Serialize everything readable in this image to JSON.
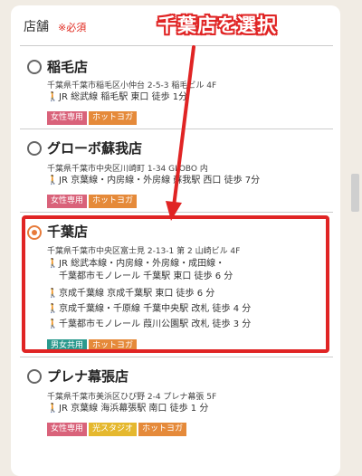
{
  "form": {
    "field_label": "店舗",
    "required_label": "※必須"
  },
  "annotation": {
    "callout_text": "千葉店を選択",
    "color": "#e02424"
  },
  "colors": {
    "women_only": "#d9627a",
    "hot_yoga": "#e58a3a",
    "unisex": "#2a9a8e",
    "light_studio": "#e5b82e",
    "walk_icon": "#e29a2b",
    "radio_selected": "#e77b3b"
  },
  "stores": [
    {
      "name": "稲毛店",
      "selected": false,
      "address": "千葉県千葉市稲毛区小仲台 2-5-3 稲毛ビル 4F",
      "access": [
        "JR 総武線 稲毛駅 東口 徒歩 1分"
      ],
      "tags": [
        "女性専用",
        "ホットヨガ"
      ]
    },
    {
      "name": "グローボ蘇我店",
      "selected": false,
      "address": "千葉県千葉市中央区川崎町 1-34 GLOBO 内",
      "access": [
        "JR 京葉線・内房線・外房線 蘇我駅 西口 徒歩 7分"
      ],
      "tags": [
        "女性専用",
        "ホットヨガ"
      ]
    },
    {
      "name": "千葉店",
      "selected": true,
      "address": "千葉県千葉市中央区富士見 2-13-1 第 2 山崎ビル 4F",
      "access": [
        "JR 総武本線・内房線・外房線・成田線・",
        "千葉都市モノレール 千葉駅 東口 徒歩 6 分",
        "京成千葉線 京成千葉駅 東口 徒歩 6 分",
        "京成千葉線・千原線 千葉中央駅 改札 徒歩 4 分",
        "千葉都市モノレール 葭川公園駅 改札 徒歩 3 分"
      ],
      "tags": [
        "男女共用",
        "ホットヨガ"
      ]
    },
    {
      "name": "プレナ幕張店",
      "selected": false,
      "address": "千葉県千葉市美浜区ひび野 2-4 プレナ幕張 5F",
      "access": [
        "JR 京葉線 海浜幕張駅 南口 徒歩 1 分"
      ],
      "tags": [
        "女性専用",
        "光スタジオ",
        "ホットヨガ"
      ]
    }
  ]
}
